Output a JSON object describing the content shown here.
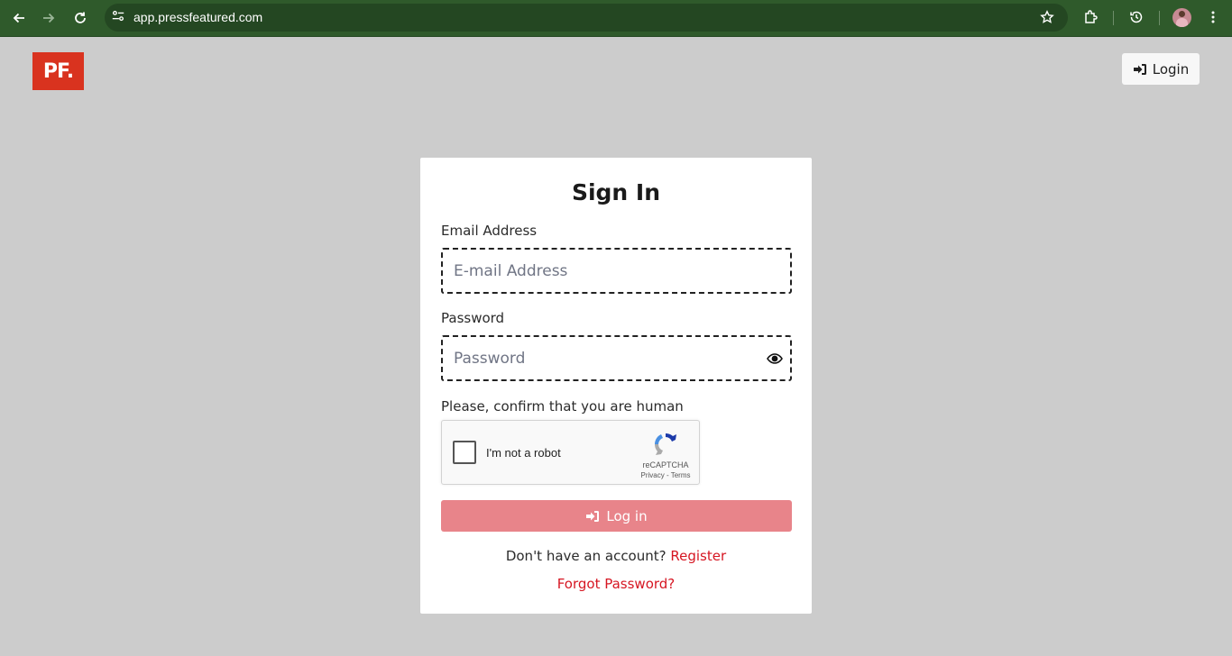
{
  "browser": {
    "url": "app.pressfeatured.com",
    "icons": [
      "back-arrow-icon",
      "forward-arrow-icon",
      "reload-icon",
      "site-info-icon",
      "bookmark-star-icon",
      "extensions-icon",
      "history-icon",
      "profile-avatar",
      "more-menu-icon"
    ]
  },
  "header": {
    "logo_text": "PF.",
    "login_label": "Login"
  },
  "signin": {
    "title": "Sign In",
    "email_label": "Email Address",
    "email_placeholder": "E-mail Address",
    "email_value": "",
    "password_label": "Password",
    "password_placeholder": "Password",
    "password_value": "",
    "captcha_prompt": "Please, confirm that you are human",
    "captcha_checkbox_label": "I'm not a robot",
    "captcha_brand": "reCAPTCHA",
    "captcha_privacy": "Privacy",
    "captcha_terms": "Terms",
    "captcha_checked": false,
    "login_button_label": "Log in",
    "no_account_text": "Don't have an account?",
    "register_link": "Register",
    "forgot_link": "Forgot Password?"
  },
  "colors": {
    "browser_bar": "#2f5a2b",
    "page_background": "#cccccc",
    "logo_background": "#d9331f",
    "login_button": "#e8848a",
    "link_red": "#d61622"
  }
}
